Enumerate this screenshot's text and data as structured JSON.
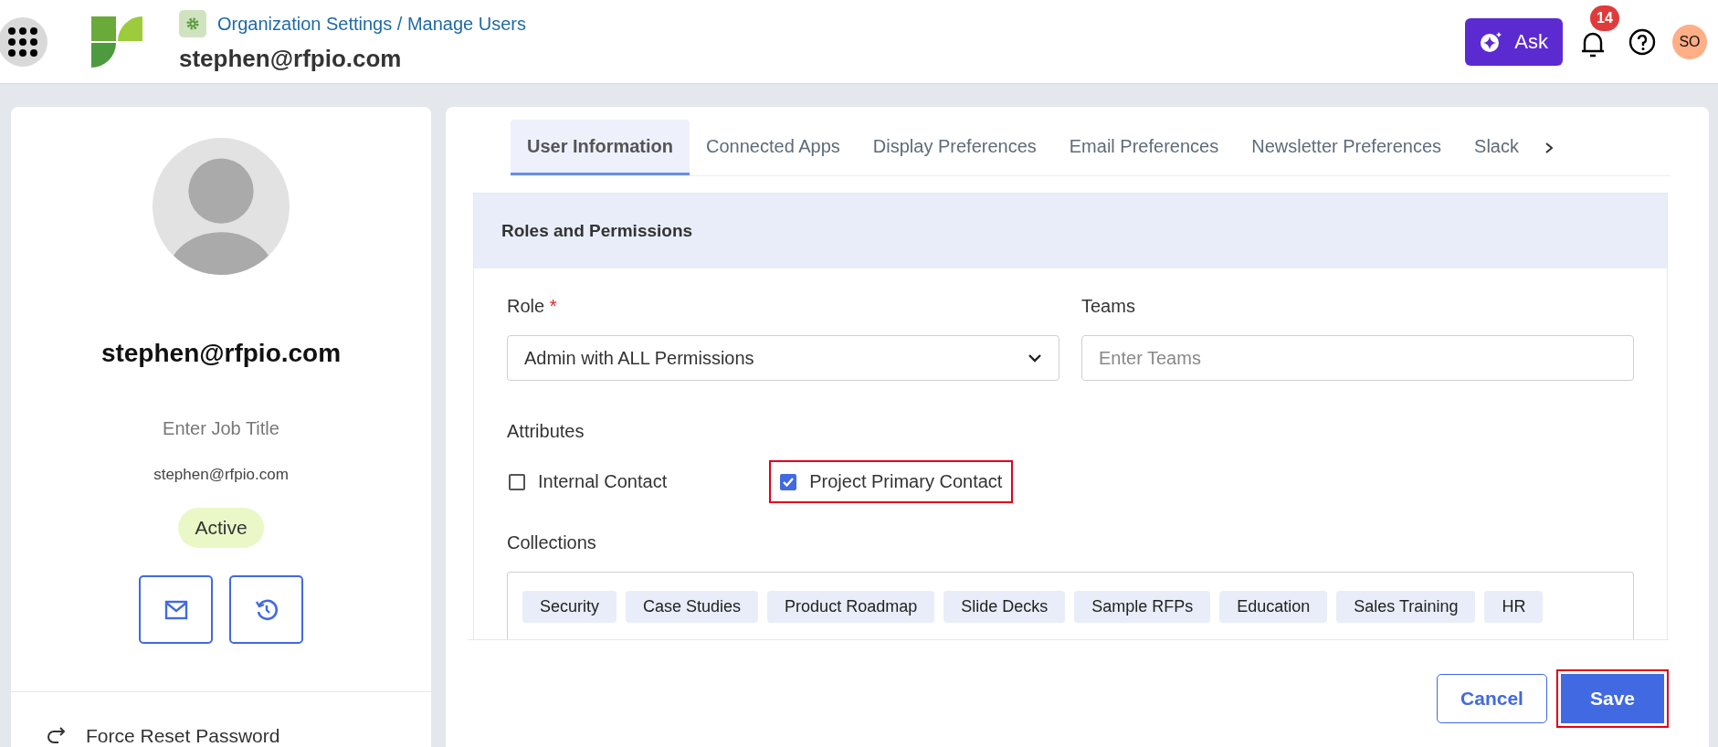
{
  "header": {
    "breadcrumb": "Organization Settings / Manage Users",
    "title": "stephen@rfpio.com",
    "ask_button": "Ask",
    "notifications": "14",
    "avatar": "SO"
  },
  "profile": {
    "name": "stephen@rfpio.com",
    "job_title_placeholder": "Enter Job Title",
    "email": "stephen@rfpio.com",
    "status": "Active",
    "reset_link": "Force Reset Password"
  },
  "tabs": [
    {
      "label": "User Information",
      "selected": true
    },
    {
      "label": "Connected Apps",
      "selected": false
    },
    {
      "label": "Display Preferences",
      "selected": false
    },
    {
      "label": "Email Preferences",
      "selected": false
    },
    {
      "label": "Newsletter Preferences",
      "selected": false
    },
    {
      "label": "Slack",
      "selected": false
    }
  ],
  "section": {
    "title": "Roles and Permissions",
    "role": {
      "label": "Role",
      "required_mark": "*",
      "value": "Admin with ALL Permissions"
    },
    "teams": {
      "label": "Teams",
      "placeholder": "Enter Teams"
    },
    "attributes_label": "Attributes",
    "attributes": [
      {
        "label": "Internal Contact",
        "checked": false,
        "highlighted": false
      },
      {
        "label": "Project Primary Contact",
        "checked": true,
        "highlighted": true
      }
    ],
    "collections_label": "Collections",
    "collections": [
      "Security",
      "Case Studies",
      "Product Roadmap",
      "Slide Decks",
      "Sample RFPs",
      "Education",
      "Sales Training",
      "HR"
    ]
  },
  "buttons": [
    {
      "label": "Cancel",
      "kind": "secondary",
      "highlighted": false
    },
    {
      "label": "Save",
      "kind": "primary",
      "highlighted": true
    }
  ]
}
